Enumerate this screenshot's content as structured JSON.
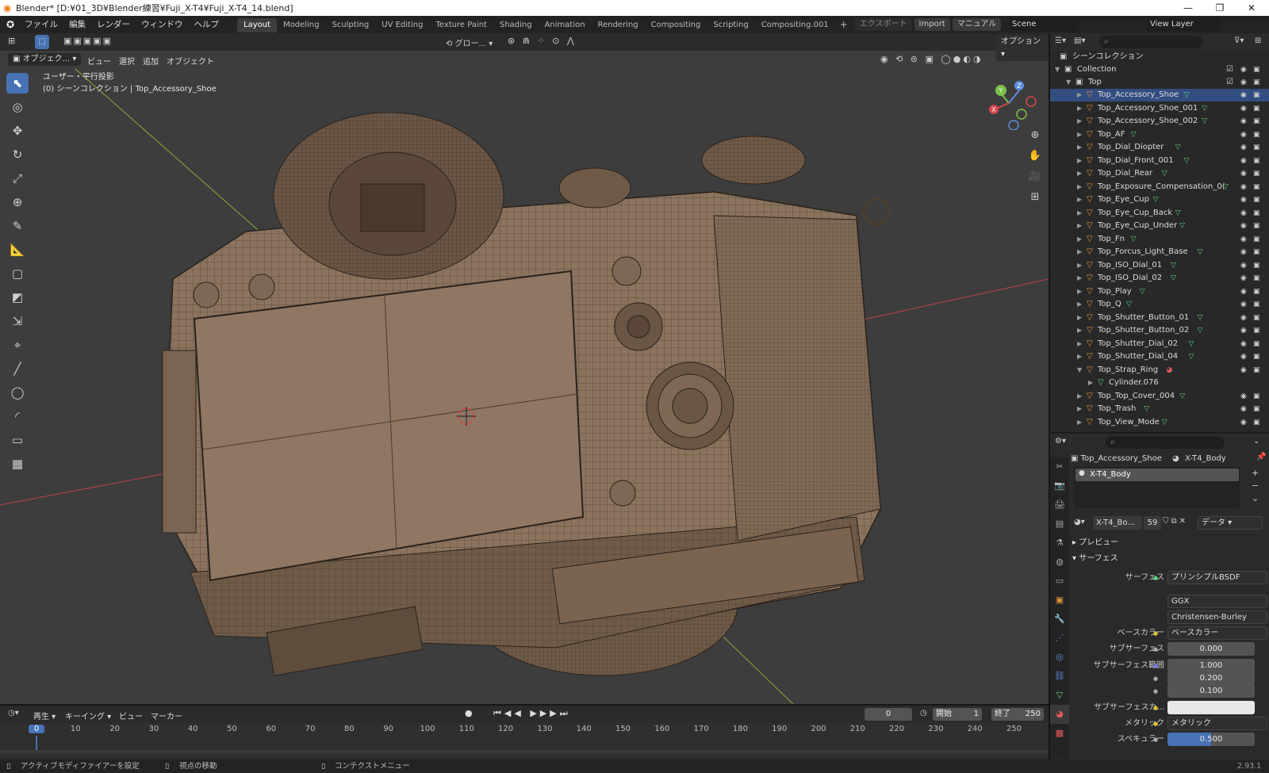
{
  "window": {
    "title": "Blender* [D:¥01_3D¥Blender練習¥Fuji_X-T4¥Fuji_X-T4_14.blend]",
    "controls": [
      "—",
      "❐",
      "✕"
    ]
  },
  "menus": [
    "ファイル",
    "編集",
    "レンダー",
    "ウィンドウ",
    "ヘルプ"
  ],
  "workspace_tabs": [
    "Layout",
    "Modeling",
    "Sculpting",
    "UV Editing",
    "Texture Paint",
    "Shading",
    "Animation",
    "Rendering",
    "Compositing",
    "Scripting",
    "Compositing.001"
  ],
  "active_tab": "Layout",
  "topbar_right": {
    "export": "エクスポート",
    "import": "Import",
    "manual": "マニュアル",
    "scene": "Scene",
    "view_layer": "View Layer"
  },
  "viewport_header": {
    "mode": "オブジェク...",
    "menus": [
      "ビュー",
      "選択",
      "追加",
      "オブジェクト"
    ],
    "transform": "グロー...",
    "options": "オプション"
  },
  "viewport_info": {
    "line1": "ユーザー・平行投影",
    "line2": "(0) シーンコレクション | Top_Accessory_Shoe"
  },
  "gizmo": {
    "x": "X",
    "y": "Y",
    "z": "Z"
  },
  "outliner": {
    "scene_collection": "シーンコレクション",
    "collection": "Collection",
    "top": "Top",
    "items": [
      "Top_Accessory_Shoe",
      "Top_Accessory_Shoe_001",
      "Top_Accessory_Shoe_002",
      "Top_AF",
      "Top_Dial_Diopter",
      "Top_Dial_Front_001",
      "Top_Dial_Rear",
      "Top_Exposure_Compensation_0(",
      "Top_Eye_Cup",
      "Top_Eye_Cup_Back",
      "Top_Eye_Cup_Under",
      "Top_Fn",
      "Top_Forcus_Light_Base",
      "Top_ISO_Dial_01",
      "Top_ISO_Dial_02",
      "Top_Play",
      "Top_Q",
      "Top_Shutter_Button_01",
      "Top_Shutter_Button_02",
      "Top_Shutter_Dial_02",
      "Top_Shutter_Dial_04",
      "Top_Strap_Ring",
      "Cylinder.076",
      "Top_Top_Cover_004",
      "Top_Trash",
      "Top_View_Mode"
    ]
  },
  "properties": {
    "breadcrumb_object": "Top_Accessory_Shoe",
    "breadcrumb_material": "X-T4_Body",
    "slot": "X-T4_Body",
    "material_name": "X-T4_Bo...",
    "users": "59",
    "link": "データ",
    "preview": "プレビュー",
    "surface_section": "サーフェス",
    "rows": [
      {
        "label": "サーフェス",
        "value": "プリンシプルBSDF"
      },
      {
        "label": "",
        "value": "GGX"
      },
      {
        "label": "",
        "value": "Christensen-Burley"
      },
      {
        "label": "ベースカラー",
        "value": "ベースカラー"
      },
      {
        "label": "サブサーフェス",
        "value": "0.000"
      },
      {
        "label": "サブサーフェス範囲",
        "value": "1.000"
      },
      {
        "label": "",
        "value": "0.200"
      },
      {
        "label": "",
        "value": "0.100"
      },
      {
        "label": "サブサーフェスカ...",
        "value": ""
      },
      {
        "label": "メタリック",
        "value": "メタリック"
      },
      {
        "label": "スペキュラー",
        "value": "0.500"
      }
    ]
  },
  "timeline": {
    "menus": [
      "再生",
      "キーイング",
      "ビュー",
      "マーカー"
    ],
    "current_frame": "0",
    "start_label": "開始",
    "start": "1",
    "end_label": "終了",
    "end": "250",
    "ticks": [
      "0",
      "10",
      "20",
      "30",
      "40",
      "50",
      "60",
      "70",
      "80",
      "90",
      "100",
      "110",
      "120",
      "130",
      "140",
      "150",
      "160",
      "170",
      "180",
      "190",
      "200",
      "210",
      "220",
      "230",
      "240",
      "250"
    ]
  },
  "statusbar": {
    "left": "アクティブモディファイアーを設定",
    "middle": "視点の移動",
    "right": "コンテクストメニュー",
    "version": "2.93.1"
  }
}
